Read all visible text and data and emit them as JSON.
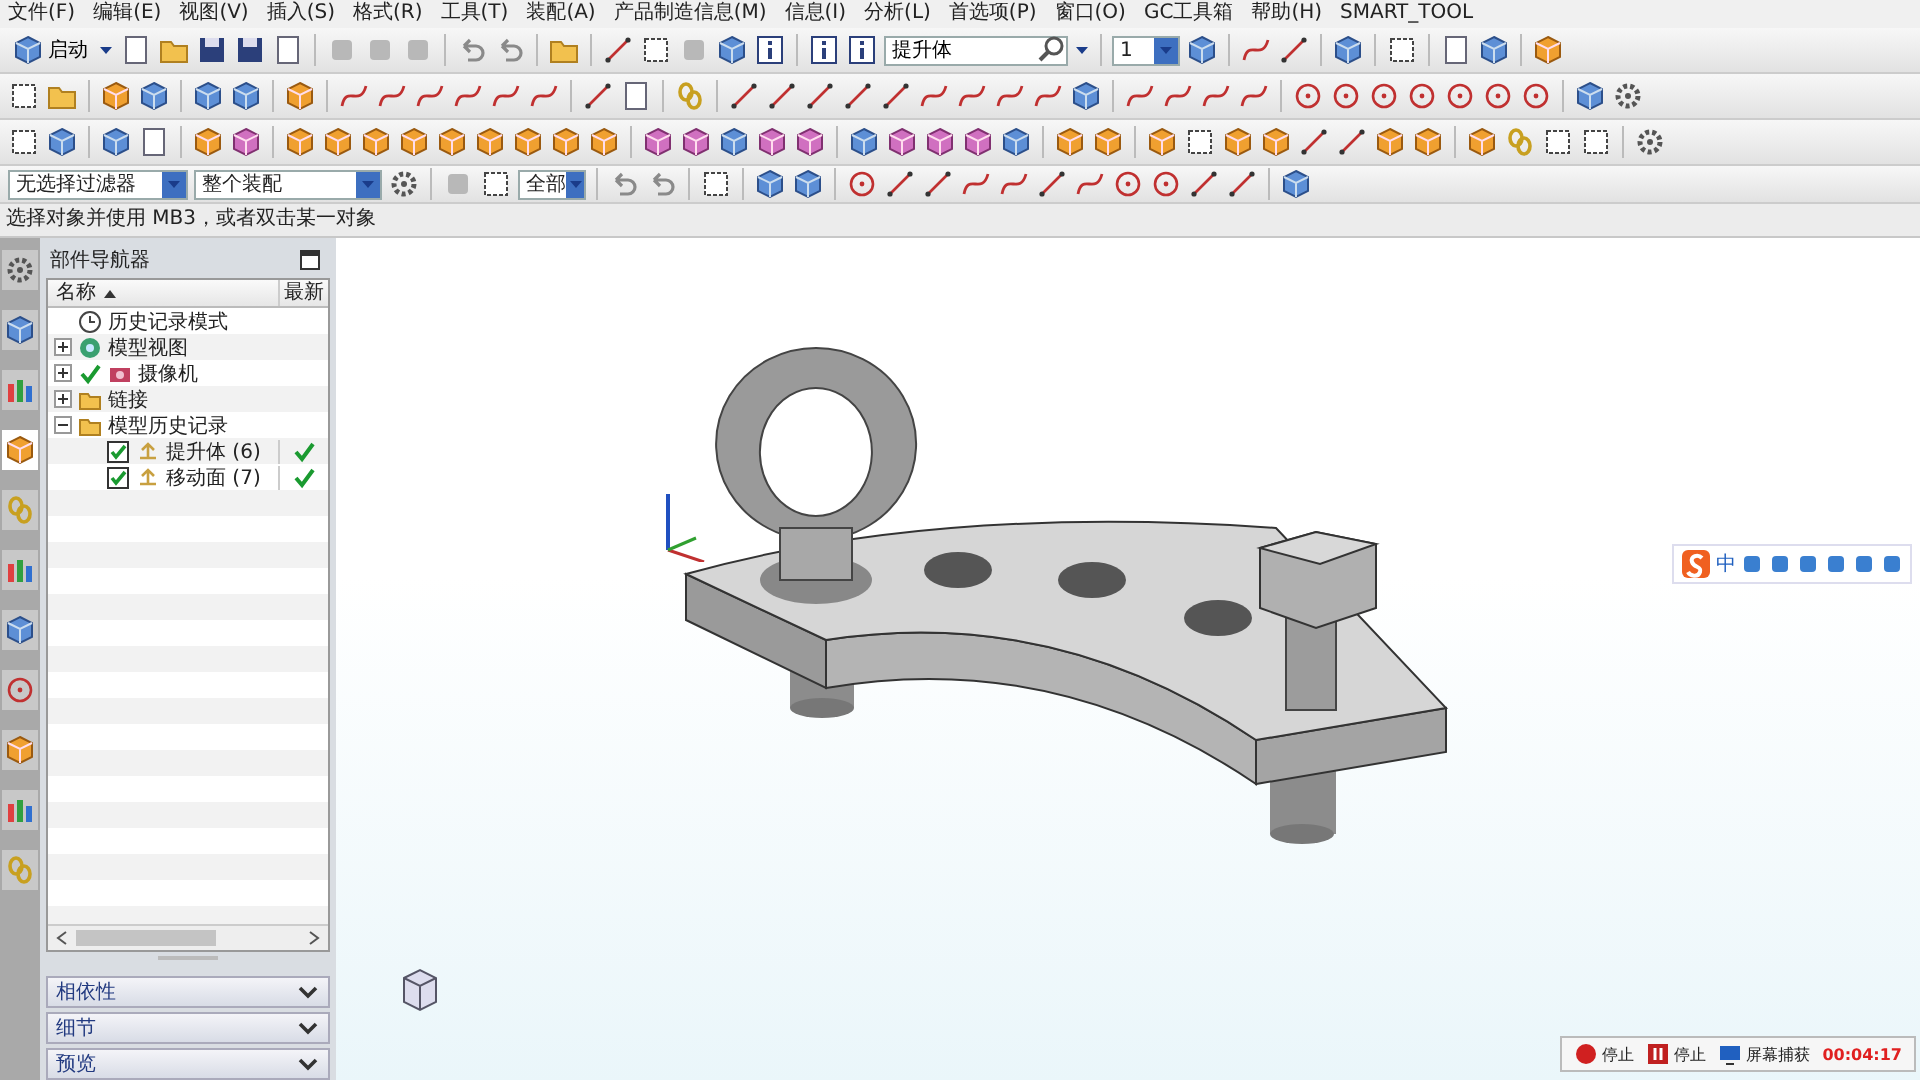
{
  "menu_bar": {
    "items": [
      "文件(F)",
      "编辑(E)",
      "视图(V)",
      "插入(S)",
      "格式(R)",
      "工具(T)",
      "装配(A)",
      "产品制造信息(M)",
      "信息(I)",
      "分析(L)",
      "首选项(P)",
      "窗口(O)",
      "GC工具箱",
      "帮助(H)",
      "SMART_TOOL"
    ]
  },
  "toolbar": {
    "start_button": "启动",
    "command_search": {
      "value": "提升体"
    },
    "layer_select": {
      "value": "1"
    }
  },
  "selection_bar": {
    "type_filter": "无选择过滤器",
    "scope": "整个装配",
    "snap_scope": "全部"
  },
  "status_bar": {
    "prompt": "选择对象并使用 MB3，或者双击某一对象"
  },
  "resource_tabs": [
    {
      "selected": false
    },
    {
      "selected": false
    },
    {
      "selected": false
    },
    {
      "selected": true
    },
    {
      "selected": false
    },
    {
      "selected": false
    },
    {
      "selected": false
    },
    {
      "selected": false
    },
    {
      "selected": false
    },
    {
      "selected": false
    },
    {
      "selected": false
    }
  ],
  "part_navigator": {
    "title": "部件导航器",
    "columns": [
      "名称",
      "最新"
    ],
    "tree": [
      {
        "label": "历史记录模式",
        "kind": "mode"
      },
      {
        "label": "模型视图",
        "kind": "views",
        "expanded": false
      },
      {
        "label": "摄像机",
        "kind": "camera",
        "expanded": false,
        "checked": true
      },
      {
        "label": "链接",
        "kind": "folder",
        "expanded": false
      },
      {
        "label": "模型历史记录",
        "kind": "folder",
        "expanded": true,
        "children": [
          {
            "label": "提升体 (6)",
            "kind": "feature",
            "checked": true,
            "up_to_date": true
          },
          {
            "label": "移动面 (7)",
            "kind": "feature",
            "checked": true,
            "up_to_date": true
          }
        ]
      }
    ],
    "panels": [
      {
        "label": "相依性",
        "expanded": false
      },
      {
        "label": "细节",
        "expanded": false
      },
      {
        "label": "预览",
        "expanded": false
      }
    ]
  },
  "ime_bar": {
    "mode": "中"
  },
  "recorder": {
    "items": [
      {
        "kind": "record",
        "label": "停止"
      },
      {
        "kind": "pause",
        "label": "停止"
      },
      {
        "kind": "screen",
        "label": "屏幕捕获"
      }
    ],
    "elapsed": "00:04:17"
  }
}
